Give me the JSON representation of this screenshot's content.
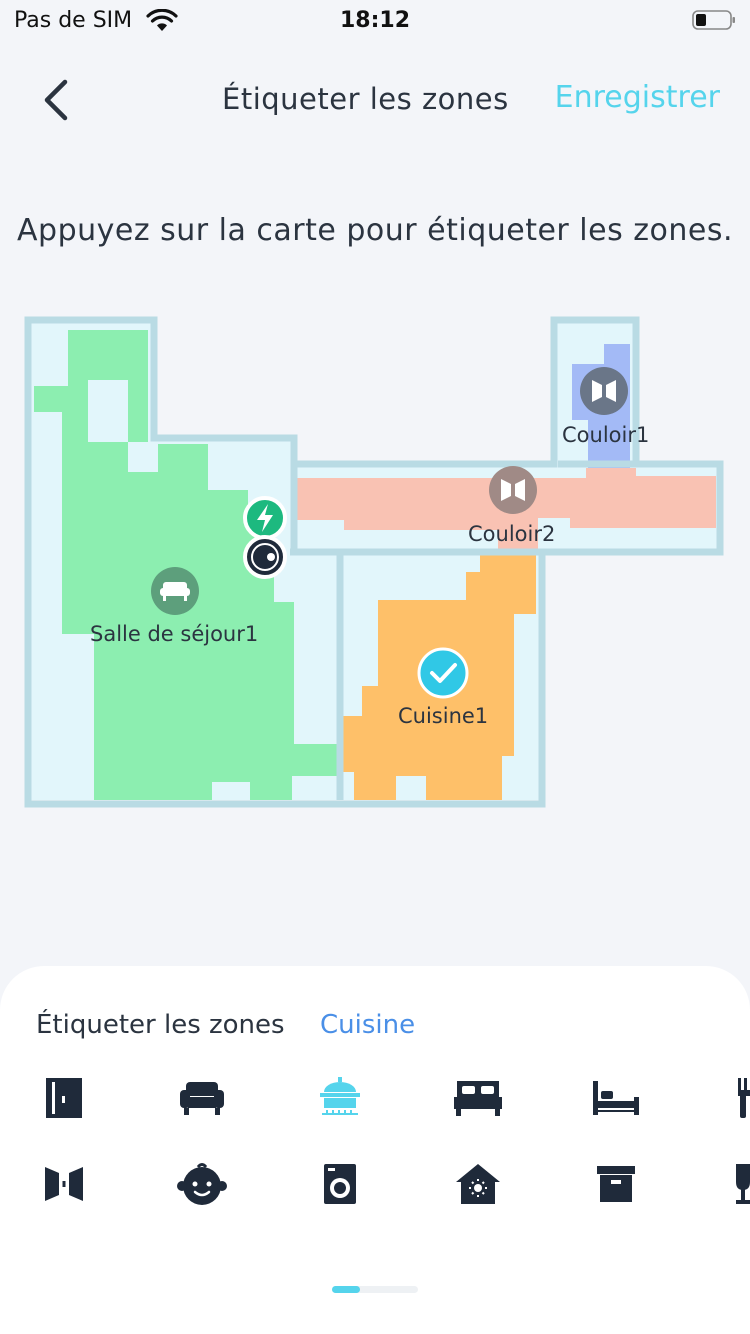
{
  "status_bar": {
    "carrier": "Pas de SIM",
    "time": "18:12"
  },
  "header": {
    "title": "Étiqueter les zones",
    "save_label": "Enregistrer"
  },
  "instruction": "Appuyez sur la carte pour étiqueter les zones.",
  "map": {
    "rooms": [
      {
        "label": "Salle de séjour1",
        "color": "#8ceeb0",
        "icon": "sofa-icon"
      },
      {
        "label": "Cuisine1",
        "color": "#fec069",
        "icon": "check-icon",
        "selected": true
      },
      {
        "label": "Couloir1",
        "color": "#a3baf6",
        "icon": "door-icon"
      },
      {
        "label": "Couloir2",
        "color": "#f9c2b3",
        "icon": "door-icon"
      }
    ],
    "wall_color": "#b9dbe4",
    "floor_color": "#e2f6fb"
  },
  "bottom_sheet": {
    "title": "Étiqueter les zones",
    "selected": "Cuisine",
    "icons_row1": [
      "wardrobe-icon",
      "sofa-icon",
      "kitchen-pot-icon",
      "double-bed-icon",
      "single-bed-icon",
      "dining-icon"
    ],
    "icons_row2": [
      "corridor-icon",
      "baby-icon",
      "washing-machine-icon",
      "house-icon",
      "storage-box-icon",
      "wine-glass-icon"
    ],
    "active_icon": "kitchen-pot-icon",
    "accent_color": "#55d4ec",
    "icon_color": "#1f2a3a"
  }
}
